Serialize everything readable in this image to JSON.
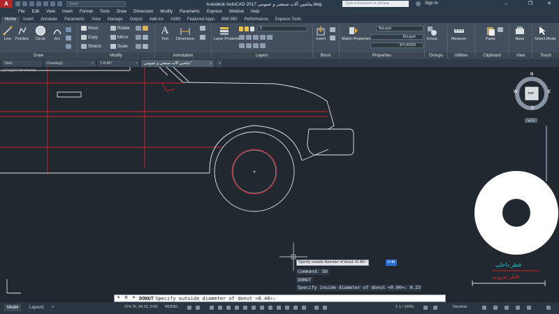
{
  "titlebar": {
    "app_title": "Autodesk AutoCAD 2017    ماشین آلات صنعتی و عمومی.dwg",
    "search_placeholder": "Type a keyword or phrase",
    "signin": "Sign In",
    "share_label": "Share"
  },
  "menu": [
    "File",
    "Edit",
    "View",
    "Insert",
    "Format",
    "Tools",
    "Draw",
    "Dimension",
    "Modify",
    "Parametric",
    "Express",
    "Window",
    "Help"
  ],
  "ribbon_tabs": [
    "Home",
    "Insert",
    "Annotate",
    "Parametric",
    "View",
    "Manage",
    "Output",
    "Add-ins",
    "A360",
    "Featured Apps",
    "BIM 360",
    "Performance",
    "Express Tools"
  ],
  "ribbon": {
    "draw": {
      "title": "Draw",
      "tools": [
        "Line",
        "Polyline",
        "Circle",
        "Arc"
      ]
    },
    "modify": {
      "title": "Modify",
      "tools": [
        "Move",
        "Rotate",
        "Copy",
        "Mirror",
        "Stretch",
        "Scale"
      ]
    },
    "annotation": {
      "title": "Annotation",
      "tools": [
        "Text",
        "Dimension"
      ]
    },
    "layers": {
      "title": "Layers",
      "tools": [
        "Layer Properties"
      ],
      "current_layer": "0"
    },
    "block": {
      "title": "Block",
      "tools": [
        "Insert"
      ]
    },
    "properties": {
      "title": "Properties",
      "tools": [
        "Match Properties"
      ],
      "color": "ByLayer",
      "linetype": "ByLayer",
      "lineweight": "BYLAYER"
    },
    "groups": {
      "title": "Groups",
      "tools": [
        "Group"
      ]
    },
    "utilities": {
      "title": "Utilities",
      "tools": [
        "Measure"
      ]
    },
    "clipboard": {
      "title": "Clipboard",
      "tools": [
        "Paste"
      ]
    },
    "view": {
      "title": "View",
      "tools": [
        "Base"
      ]
    },
    "touch": {
      "title": "Touch",
      "tools": [
        "Select Mode"
      ]
    }
  },
  "doc_tabs": [
    "Start",
    "Drawing1",
    "7-8.85*",
    "ماشین آلات صنعتی و عمومی*"
  ],
  "viewcube": {
    "n": "N",
    "s": "S",
    "e": "E",
    "w": "W",
    "face": "TOP",
    "ucs": "WCS"
  },
  "canvas": {
    "inner_label": "قطر داخلی",
    "outer_label": "قطر بیرونی",
    "tooltip_prompt": "Specify outside diameter of donut <0.46>:",
    "tooltip_value": "0.46",
    "vp_label": "[-][Top][2D Wireframe]"
  },
  "command": {
    "history": [
      "Command: DO",
      "DONUT",
      "Specify inside diameter of donut <0.00>: 0.23"
    ],
    "current_cmd": "DONUT",
    "current_prompt": "Specify outside diameter of donut <0.46>:"
  },
  "statusbar": {
    "tabs": [
      "Model",
      "Layout1"
    ],
    "coords": "374.76, 64.15, 0.00",
    "model": "MODEL",
    "scale": "1:1 / 100%",
    "units": "Decimal"
  },
  "colors": {
    "background": "#212830",
    "red_layer": "#d2202b",
    "inner_label": "#22c6d2",
    "outer_label": "#d82222"
  }
}
